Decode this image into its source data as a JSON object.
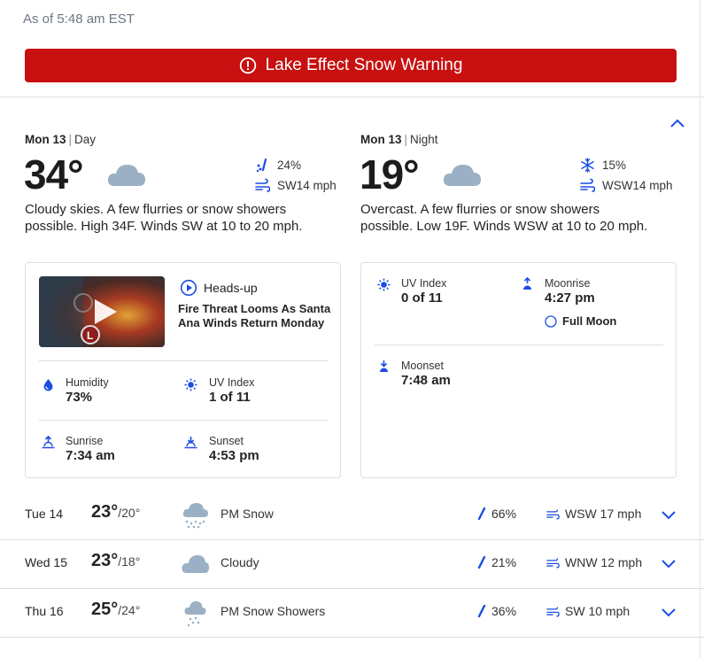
{
  "header": {
    "as_of": "As of 5:48 am EST"
  },
  "alert": {
    "label": "Lake Effect Snow Warning"
  },
  "day": {
    "date": "Mon 13",
    "part": "Day",
    "temp": "34°",
    "icon": "cloud-icon",
    "precip": "24%",
    "wind": "SW14 mph",
    "narrative": "Cloudy skies. A few flurries or snow showers possible. High 34F. Winds SW at 10 to 20 mph.",
    "video": {
      "label": "Heads-up",
      "title": "Fire Threat Looms As Santa Ana Winds Return Monday"
    },
    "humidity_label": "Humidity",
    "humidity": "73%",
    "uv_label": "UV Index",
    "uv": "1 of 11",
    "sunrise_label": "Sunrise",
    "sunrise": "7:34 am",
    "sunset_label": "Sunset",
    "sunset": "4:53 pm"
  },
  "night": {
    "date": "Mon 13",
    "part": "Night",
    "temp": "19°",
    "icon": "cloud-icon",
    "precip": "15%",
    "wind": "WSW14 mph",
    "narrative": "Overcast. A few flurries or snow showers possible. Low 19F. Winds WSW at 10 to 20 mph.",
    "uv_label": "UV Index",
    "uv": "0 of 11",
    "moonrise_label": "Moonrise",
    "moonrise": "4:27 pm",
    "moon_phase": "Full Moon",
    "moonset_label": "Moonset",
    "moonset": "7:48 am"
  },
  "forecast": [
    {
      "day": "Tue 14",
      "hi": "23°",
      "lo": "/20°",
      "cond": "PM Snow",
      "icon": "snow-icon",
      "precip": "66%",
      "wind": "WSW 17 mph"
    },
    {
      "day": "Wed 15",
      "hi": "23°",
      "lo": "/18°",
      "cond": "Cloudy",
      "icon": "cloud-icon",
      "precip": "21%",
      "wind": "WNW 12 mph"
    },
    {
      "day": "Thu 16",
      "hi": "25°",
      "lo": "/24°",
      "cond": "PM Snow Showers",
      "icon": "snow-showers-icon",
      "precip": "36%",
      "wind": "SW 10 mph"
    }
  ],
  "colors": {
    "alert": "#c7100f",
    "accent": "#1b4de4",
    "cloud": "#9bb0c4"
  }
}
